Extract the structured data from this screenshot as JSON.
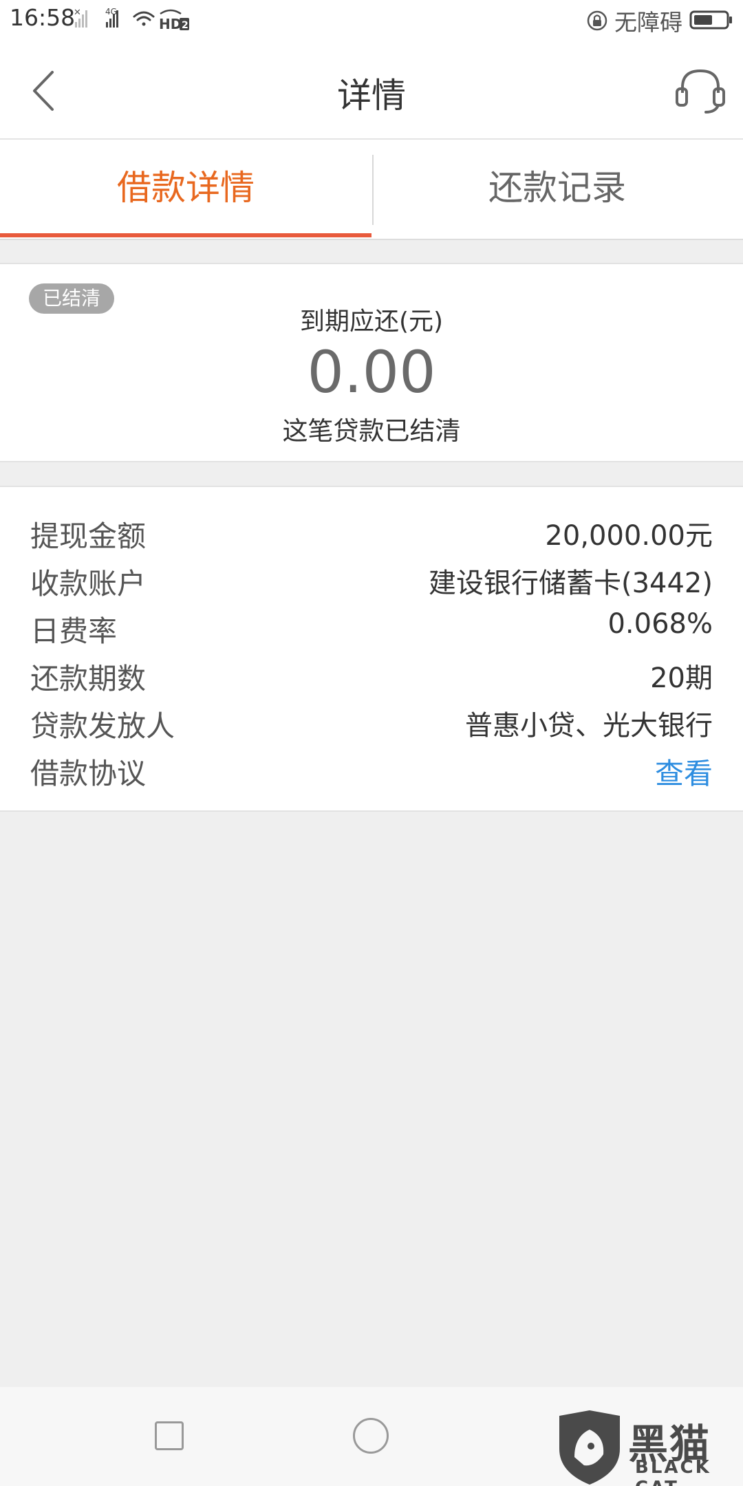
{
  "status_bar": {
    "time": "16:58",
    "network": "4G",
    "hd_label": "HD2",
    "accessibility_text": "无障碍"
  },
  "header": {
    "title": "详情"
  },
  "tabs": [
    {
      "label": "借款详情",
      "active": true
    },
    {
      "label": "还款记录",
      "active": false
    }
  ],
  "summary": {
    "badge": "已结清",
    "due_label": "到期应还(元)",
    "due_amount": "0.00",
    "status_text": "这笔贷款已结清"
  },
  "details": [
    {
      "label": "提现金额",
      "value": "20,000.00元"
    },
    {
      "label": "收款账户",
      "value": "建设银行储蓄卡(3442)"
    },
    {
      "label": "日费率",
      "value": "0.068%"
    },
    {
      "label": "还款期数",
      "value": "20期"
    },
    {
      "label": "贷款发放人",
      "value": "普惠小贷、光大银行"
    },
    {
      "label": "借款协议",
      "value": "查看"
    }
  ],
  "watermark": {
    "zh": "黑猫",
    "en": "BLACK CAT"
  },
  "colors": {
    "accent_orange": "#e8681f",
    "indicator": "#e85a3c",
    "link_blue": "#2d8de0",
    "badge_gray": "#a7a7a7",
    "background": "#efefef"
  }
}
